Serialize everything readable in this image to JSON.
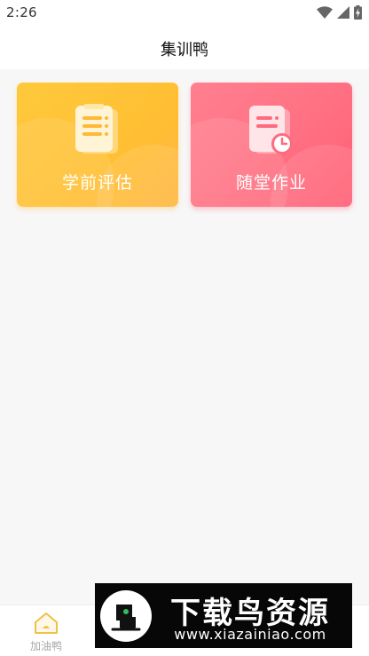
{
  "status_bar": {
    "time": "2:26"
  },
  "app_bar": {
    "title": "集训鸭"
  },
  "cards": [
    {
      "label": "学前评估",
      "icon": "clipboard-icon",
      "color": "#ffc13a"
    },
    {
      "label": "随堂作业",
      "icon": "document-clock-icon",
      "color": "#ff6b7e"
    }
  ],
  "tab_bar": {
    "tabs": [
      {
        "label": "加油鸭",
        "icon": "home-icon",
        "active": true
      }
    ]
  },
  "watermark": {
    "title": "下载鸟资源",
    "url": "www.xiazainiao.com"
  }
}
